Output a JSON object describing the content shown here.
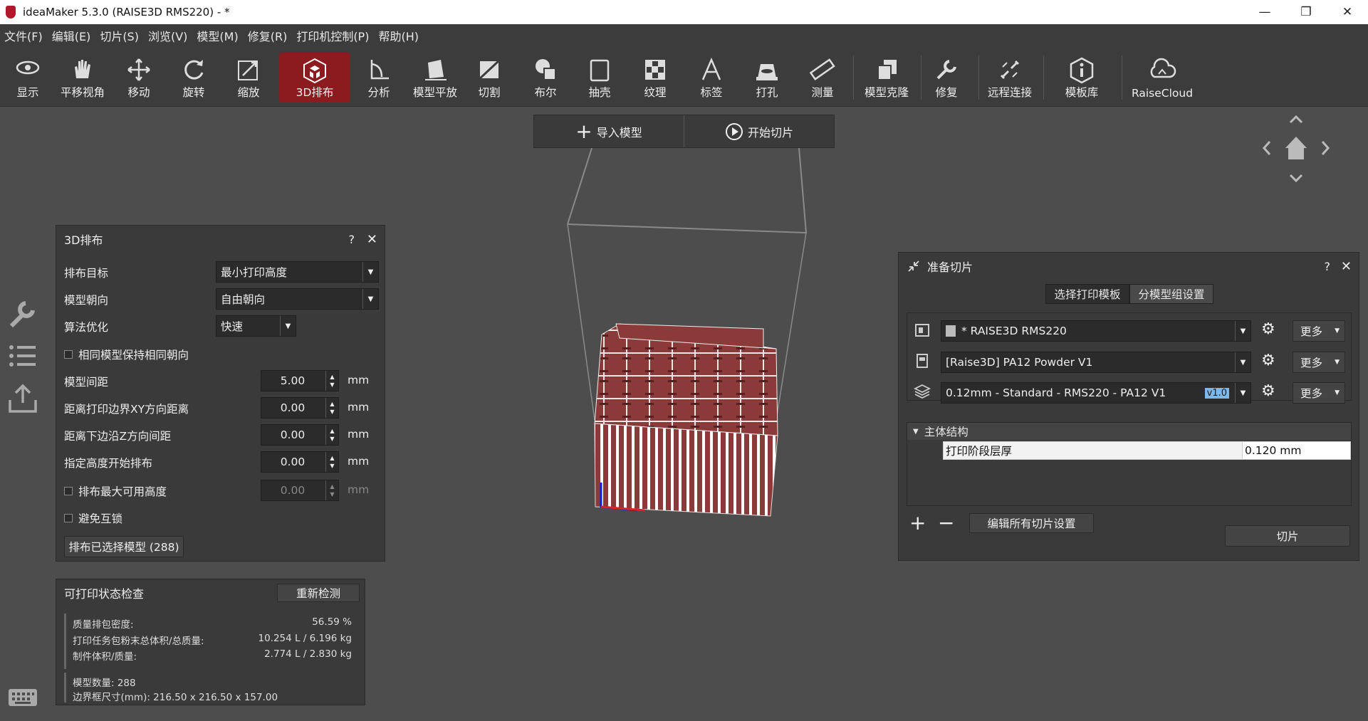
{
  "window": {
    "title": "ideaMaker 5.3.0 (RAISE3D RMS220) - *",
    "minimize": "—",
    "restore": "❐",
    "close": "✕"
  },
  "menu": [
    "文件(F)",
    "编辑(E)",
    "切片(S)",
    "浏览(V)",
    "模型(M)",
    "修复(R)",
    "打印机控制(P)",
    "帮助(H)"
  ],
  "toolbar": {
    "items": [
      "显示",
      "平移视角",
      "移动",
      "旋转",
      "缩放",
      "3D排布",
      "分析",
      "模型平放",
      "切割",
      "布尔",
      "抽壳",
      "纹理",
      "标签",
      "打孔",
      "测量",
      "模型克隆",
      "修复",
      "远程连接",
      "模板库",
      "RaiseCloud"
    ],
    "active": "3D排布"
  },
  "viewport_buttons": {
    "import": "导入模型",
    "slice": "开始切片"
  },
  "arrange_panel": {
    "title": "3D排布",
    "help": "?",
    "close": "✕",
    "target_label": "排布目标",
    "target_value": "最小打印高度",
    "orientation_label": "模型朝向",
    "orientation_value": "自由朝向",
    "algo_label": "算法优化",
    "algo_value": "快速",
    "same_orient_label": "相同模型保持相同朝向",
    "spacing_label": "模型间距",
    "spacing_value": "5.00",
    "xy_label": "距离打印边界XY方向距离",
    "xy_value": "0.00",
    "z_label": "距离下边沿Z方向间距",
    "z_value": "0.00",
    "start_height_label": "指定高度开始排布",
    "start_height_value": "0.00",
    "max_height_label": "排布最大可用高度",
    "max_height_value": "0.00",
    "interlock_label": "避免互锁",
    "unit": "mm",
    "arrange_button": "排布已选择模型 (288)"
  },
  "status_panel": {
    "title": "可打印状态检查",
    "recheck": "重新检测",
    "density_label": "质量排包密度:",
    "density_value": "56.59 %",
    "powder_label": "打印任务包粉末总体积/总质量:",
    "powder_value": "10.254 L / 6.196 kg",
    "part_label": "制件体积/质量:",
    "part_value": "2.774 L / 2.830 kg",
    "count_text": "模型数量: 288",
    "bbox_text": "边界框尺寸(mm): 216.50 x 216.50 x 157.00"
  },
  "slice_panel": {
    "title": "准备切片",
    "help": "?",
    "close": "✕",
    "tab_template": "选择打印模板",
    "tab_group": "分模型组设置",
    "printer": "* RAISE3D RMS220",
    "material": "[Raise3D] PA12 Powder V1",
    "profile": "0.12mm - Standard - RMS220 - PA12 V1",
    "profile_badge": "v1.0",
    "more": "更多",
    "section": "主体结构",
    "param_label": "打印阶段层厚",
    "param_value": "0.120 mm",
    "plus": "+",
    "minus": "−",
    "edit_all": "编辑所有切片设置",
    "slice_button": "切片"
  },
  "colors": {
    "accent": "#8c1b1f",
    "bg": "#4d4d4d",
    "panel": "#3a3a3a",
    "model": "#8b3a3a"
  }
}
